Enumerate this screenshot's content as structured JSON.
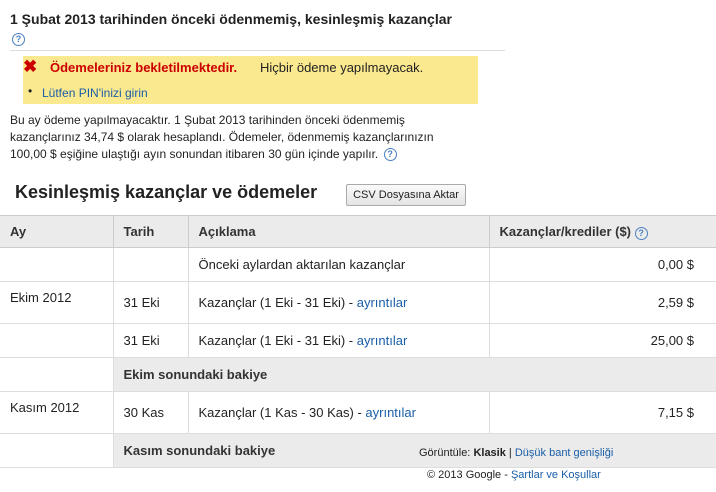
{
  "top": {
    "title": "1 Şubat 2013 tarihinden önceki ödenmemiş, kesinleşmiş kazançlar",
    "help": "?"
  },
  "alert": {
    "icon": "✖",
    "bold": "Ödemeleriniz bekletilmektedir.",
    "rest": "Hiçbir ödeme yapılmayacak.",
    "bullet": "•",
    "link": "Lütfen PIN'inizi girin"
  },
  "info": {
    "text": "Bu ay ödeme yapılmayacaktır. 1 Şubat 2013 tarihinden önceki ödenmemiş kazançlarınız 34,74 $ olarak hesaplandı. Ödemeler, ödenmemiş kazançlarınızın 100,00 $ eşiğine ulaştığı ayın sonundan itibaren 30 gün içinde yapılır.",
    "help": "?"
  },
  "section": {
    "title": "Kesinleşmiş kazançlar ve ödemeler",
    "csv_button": "CSV Dosyasına Aktar"
  },
  "table": {
    "headers": {
      "month": "Ay",
      "date": "Tarih",
      "desc": "Açıklama",
      "amount": "Kazançlar/krediler ($)"
    },
    "help": "?",
    "rows": [
      {
        "month": "",
        "date": "",
        "desc": "Önceki aylardan aktarılan kazançlar",
        "link": "",
        "amount": "0,00 $"
      },
      {
        "month": "Ekim 2012",
        "date": "31 Eki",
        "desc": "Kazançlar (1 Eki - 31 Eki) - ",
        "link": "ayrıntılar",
        "amount": "2,59 $"
      },
      {
        "month": "",
        "date": "31 Eki",
        "desc": "Kazançlar (1 Eki - 31 Eki) - ",
        "link": "ayrıntılar",
        "amount": "25,00 $"
      },
      {
        "balance": "Ekim sonundaki bakiye"
      },
      {
        "month": "Kasım 2012",
        "date": "30 Kas",
        "desc": "Kazançlar (1 Kas - 30 Kas) - ",
        "link": "ayrıntılar",
        "amount": "7,15 $"
      },
      {
        "balance": "Kasım sonundaki bakiye"
      }
    ]
  },
  "footer": {
    "view_label": "Görüntüle:",
    "classic": "Klasik",
    "sep": "|",
    "low_bandwidth": "Düşük bant genişliği",
    "copyright": "© 2013 Google -",
    "terms": "Şartlar ve Koşullar"
  }
}
